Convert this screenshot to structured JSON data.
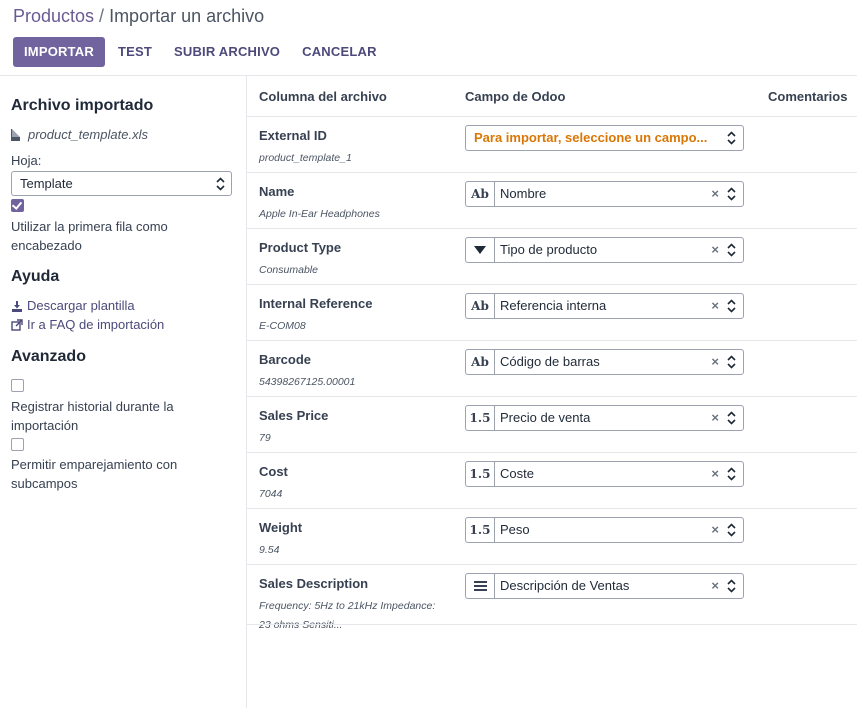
{
  "breadcrumb": {
    "parent": "Productos",
    "current": "Importar un archivo"
  },
  "toolbar": {
    "import": "IMPORTAR",
    "test": "TEST",
    "upload": "SUBIR ARCHIVO",
    "cancel": "CANCELAR"
  },
  "sidebar": {
    "imported_title": "Archivo importado",
    "filename": "product_template.xls",
    "sheet_label": "Hoja:",
    "sheet_value": "Template",
    "first_row_header": "Utilizar la primera fila como encabezado",
    "help_title": "Ayuda",
    "download_template": "Descargar plantilla",
    "faq": "Ir a FAQ de importación",
    "advanced_title": "Avanzado",
    "track_history": "Registrar historial durante la importación",
    "subfields": "Permitir emparejamiento con subcampos"
  },
  "table": {
    "headers": {
      "column": "Columna del archivo",
      "field": "Campo de Odoo",
      "comments": "Comentarios"
    },
    "rows": [
      {
        "name": "External ID",
        "sample": "product_template_1",
        "type": "",
        "field": "Para importar, seleccione un campo...",
        "warn": true
      },
      {
        "name": "Name",
        "sample": "Apple In-Ear Headphones",
        "type": "Ab",
        "field": "Nombre"
      },
      {
        "name": "Product Type",
        "sample": "Consumable",
        "type": "select",
        "field": "Tipo de producto"
      },
      {
        "name": "Internal Reference",
        "sample": "E-COM08",
        "type": "Ab",
        "field": "Referencia interna"
      },
      {
        "name": "Barcode",
        "sample": "54398267125.00001",
        "type": "Ab",
        "field": "Código de barras"
      },
      {
        "name": "Sales Price",
        "sample": "79",
        "type": "1.5",
        "field": "Precio de venta"
      },
      {
        "name": "Cost",
        "sample": "7044",
        "type": "1.5",
        "field": "Coste"
      },
      {
        "name": "Weight",
        "sample": "9.54",
        "type": "1.5",
        "field": "Peso"
      },
      {
        "name": "Sales Description",
        "sample": "Frequency: 5Hz to 21kHz Impedance: 23 ohms Sensiti...",
        "type": "text",
        "field": "Descripción de Ventas"
      }
    ]
  },
  "colors": {
    "primary": "#71639e",
    "warning": "#d97706"
  }
}
